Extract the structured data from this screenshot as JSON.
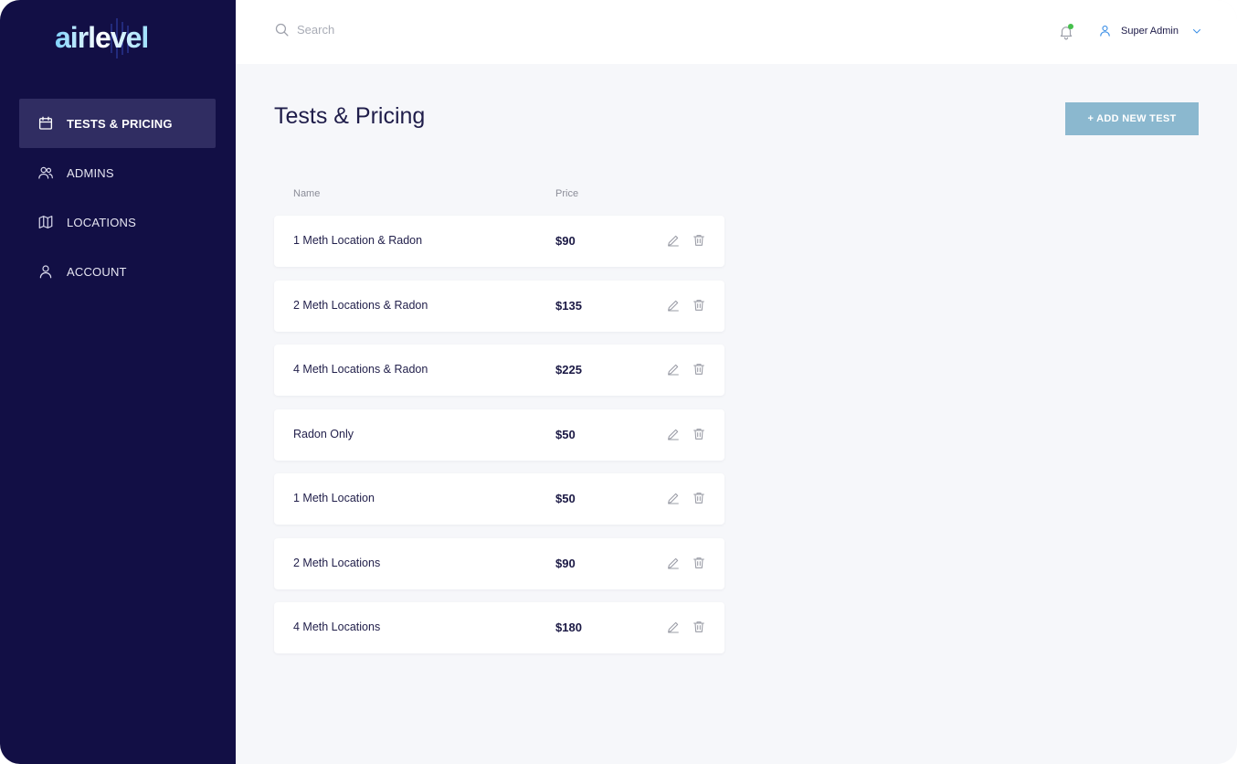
{
  "app": {
    "logo_text": "airlevel"
  },
  "sidebar": {
    "items": [
      {
        "label": "TESTS & PRICING",
        "icon": "calendar-icon",
        "active": true
      },
      {
        "label": "ADMINS",
        "icon": "users-icon",
        "active": false
      },
      {
        "label": "LOCATIONS",
        "icon": "map-icon",
        "active": false
      },
      {
        "label": "ACCOUNT",
        "icon": "user-icon",
        "active": false
      }
    ]
  },
  "topbar": {
    "search_placeholder": "Search",
    "search_value": "",
    "notification_icon": "bell-icon",
    "user_name": "Super Admin",
    "user_icon": "user-icon",
    "chevron_icon": "chevron-down-icon"
  },
  "main": {
    "title": "Tests & Pricing",
    "add_button_label": "+ ADD NEW TEST",
    "table": {
      "columns": [
        "Name",
        "Price"
      ],
      "rows": [
        {
          "name": "1 Meth Location & Radon",
          "price": "$90"
        },
        {
          "name": "2 Meth Locations & Radon",
          "price": "$135"
        },
        {
          "name": "4 Meth Locations & Radon",
          "price": "$225"
        },
        {
          "name": "Radon Only",
          "price": "$50"
        },
        {
          "name": "1 Meth Location",
          "price": "$50"
        },
        {
          "name": "2 Meth Locations",
          "price": "$90"
        },
        {
          "name": "4 Meth Locations",
          "price": "$180"
        }
      ]
    }
  },
  "colors": {
    "sidebar_bg": "#120f45",
    "sidebar_active": "#302d62",
    "accent_button": "#8bb8cf",
    "notification_dot": "#45c04c",
    "page_bg": "#f6f7fa"
  }
}
